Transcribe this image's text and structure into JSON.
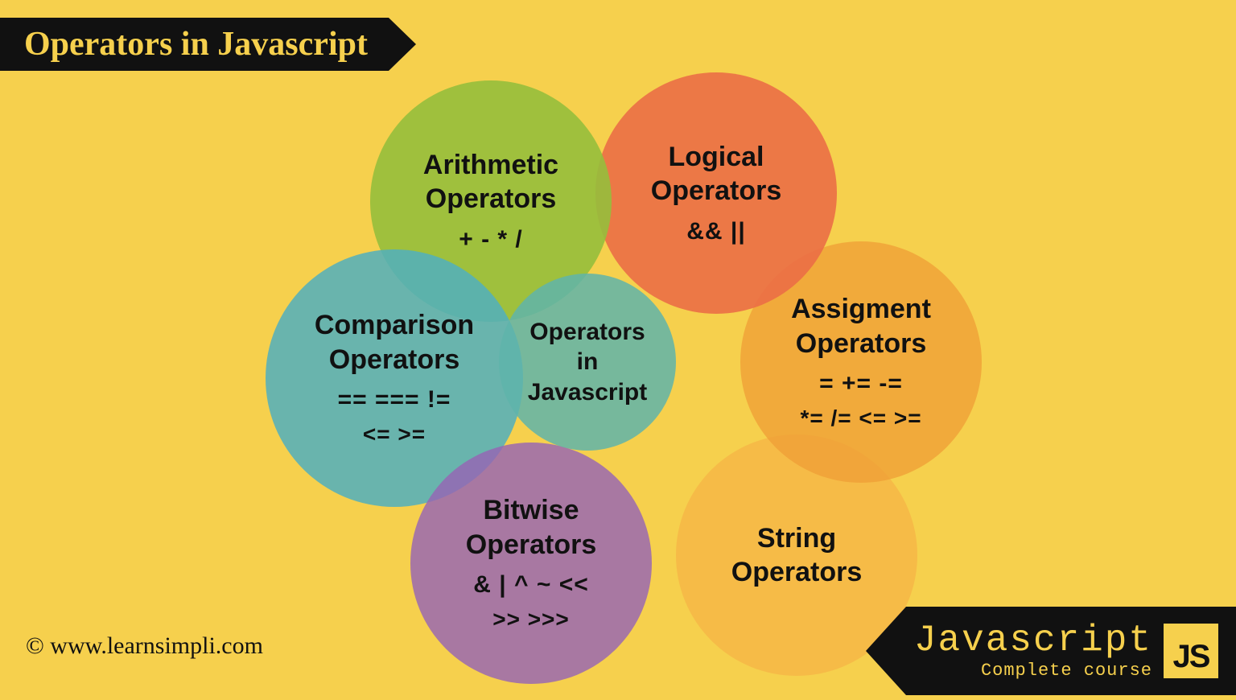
{
  "title": "Operators in Javascript",
  "copyright": "© www.learnsimpli.com",
  "brand": {
    "line1": "Javascript",
    "line2": "Complete course",
    "badge": "JS"
  },
  "center": {
    "l1": "Operators",
    "l2": "in",
    "l3": "Javascript"
  },
  "bubbles": {
    "arithmetic": {
      "l1": "Arithmetic",
      "l2": "Operators",
      "sym": "+  -  *  /"
    },
    "logical": {
      "l1": "Logical",
      "l2": "Operators",
      "sym": "&&  ||"
    },
    "comparison": {
      "l1": "Comparison",
      "l2": "Operators",
      "sym1": "==   ===   !=",
      "sym2": "<=  >="
    },
    "assignment": {
      "l1": "Assigment",
      "l2": "Operators",
      "sym1": "=   +=   -=",
      "sym2": "*=  /=  <=  >="
    },
    "bitwise": {
      "l1": "Bitwise",
      "l2": "Operators",
      "sym1": "&  |  ^  ~  <<",
      "sym2": ">>  >>>"
    },
    "string": {
      "l1": "String",
      "l2": "Operators"
    }
  },
  "colors": {
    "arithmetic": "rgba(150,190,60,0.90)",
    "logical": "rgba(235,110,70,0.90)",
    "comparison": "rgba(80,175,190,0.85)",
    "assignment": "rgba(240,160,55,0.80)",
    "bitwise": "rgba(150,100,180,0.82)",
    "string": "rgba(245,180,70,0.75)",
    "center": "rgba(95,180,170,0.85)"
  }
}
